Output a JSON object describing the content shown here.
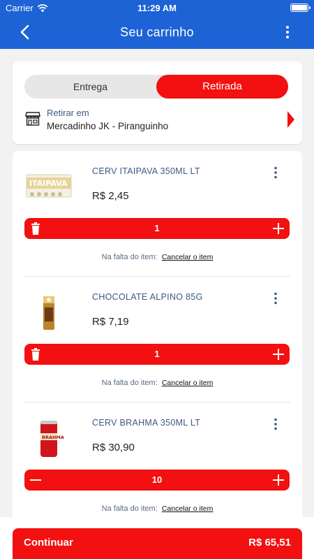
{
  "status_bar": {
    "carrier": "Carrier",
    "time": "11:29 AM"
  },
  "header": {
    "title": "Seu carrinho",
    "back_icon": "chevron-left-icon",
    "menu_icon": "kebab-menu-icon"
  },
  "delivery_toggle": {
    "options": [
      "Entrega",
      "Retirada"
    ],
    "selected": "Retirada"
  },
  "pickup": {
    "label": "Retirar em",
    "store": "Mercadinho JK - Piranguinho"
  },
  "colors": {
    "primary_blue": "#1e63d6",
    "accent_red": "#f21010",
    "label_blue": "#3d5a80"
  },
  "cart": {
    "missing_label": "Na falta do item:",
    "cancel_label": "Cancelar o item",
    "items": [
      {
        "name": "CERV ITAIPAVA 350ML LT",
        "price": "R$ 2,45",
        "quantity": "1",
        "left_icon": "trash-icon"
      },
      {
        "name": "CHOCOLATE ALPINO 85G",
        "price": "R$ 7,19",
        "quantity": "1",
        "left_icon": "trash-icon"
      },
      {
        "name": "CERV BRAHMA 350ML LT",
        "price": "R$ 30,90",
        "quantity": "10",
        "left_icon": "minus-icon"
      }
    ]
  },
  "footer": {
    "continue_label": "Continuar",
    "total": "R$ 65,51"
  }
}
